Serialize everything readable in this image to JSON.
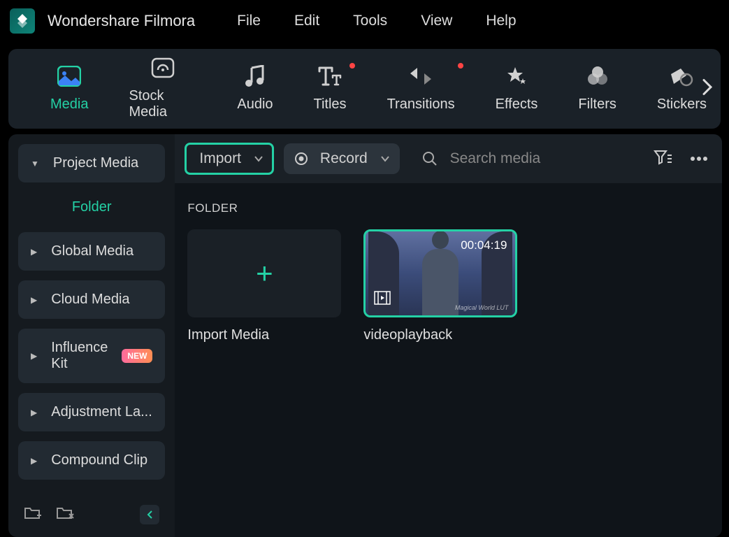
{
  "app": {
    "title": "Wondershare Filmora"
  },
  "menu": {
    "file": "File",
    "edit": "Edit",
    "tools": "Tools",
    "view": "View",
    "help": "Help"
  },
  "tools": {
    "media": "Media",
    "stock_media": "Stock Media",
    "audio": "Audio",
    "titles": "Titles",
    "transitions": "Transitions",
    "effects": "Effects",
    "filters": "Filters",
    "stickers": "Stickers"
  },
  "sidebar": {
    "project_media": "Project Media",
    "folder": "Folder",
    "global_media": "Global Media",
    "cloud_media": "Cloud Media",
    "influence_kit": "Influence Kit",
    "influence_badge": "NEW",
    "adjustment_layer": "Adjustment La...",
    "compound_clip": "Compound Clip"
  },
  "content": {
    "import_btn": "Import",
    "record_btn": "Record",
    "search_placeholder": "Search media",
    "section_title": "FOLDER",
    "tiles": {
      "import": "Import Media",
      "video": {
        "label": "videoplayback",
        "timestamp": "00:04:19",
        "watermark": "Magical World LUT"
      }
    }
  }
}
